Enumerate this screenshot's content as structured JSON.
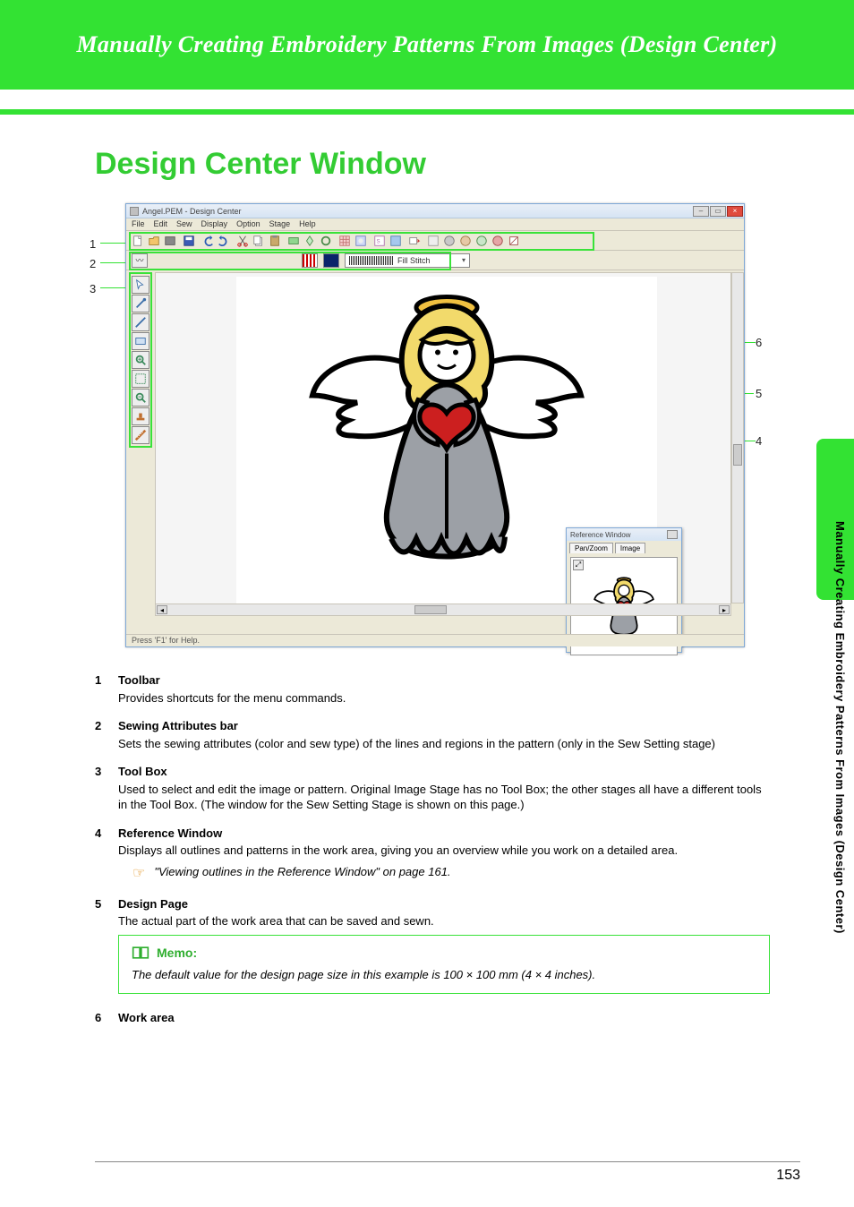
{
  "header": {
    "banner_title": "Manually Creating Embroidery Patterns From Images (Design Center)"
  },
  "heading": "Design Center Window",
  "window": {
    "title": "Angel.PEM - Design Center",
    "menus": [
      "File",
      "Edit",
      "Sew",
      "Display",
      "Option",
      "Stage",
      "Help"
    ],
    "stitch_label": "Fill Stitch",
    "statusbar": "Press 'F1' for Help.",
    "reference": {
      "title": "Reference Window",
      "tabs": [
        "Pan/Zoom",
        "Image"
      ]
    }
  },
  "callouts": {
    "n1": "1",
    "n2": "2",
    "n3": "3",
    "n4": "4",
    "n5": "5",
    "n6": "6"
  },
  "items": [
    {
      "num": "1",
      "title": "Toolbar",
      "desc": "Provides shortcuts for the menu commands."
    },
    {
      "num": "2",
      "title": "Sewing Attributes bar",
      "desc": "Sets the sewing attributes (color and sew type) of the lines and regions in the pattern (only in the Sew Setting stage)"
    },
    {
      "num": "3",
      "title": "Tool Box",
      "desc": "Used to select and edit the image or pattern. Original Image Stage has no Tool Box; the other stages all have a different tools in the Tool Box. (The window for the Sew Setting Stage is shown on this page.)"
    },
    {
      "num": "4",
      "title": "Reference Window",
      "desc": "Displays all outlines and patterns in the work area, giving you an overview while you work on a detailed area."
    },
    {
      "num": "5",
      "title": "Design Page",
      "desc": "The actual part of the work area that can be saved and sewn."
    },
    {
      "num": "6",
      "title": "Work area",
      "desc": ""
    }
  ],
  "xref": "\"Viewing outlines in the Reference Window\" on page 161.",
  "memo": {
    "label": "Memo:",
    "text": "The default value for the design page size in this example is 100 × 100 mm (4 × 4 inches)."
  },
  "sidetext": "Manually Creating Embroidery Patterns From Images (Design Center)",
  "page_number": "153"
}
